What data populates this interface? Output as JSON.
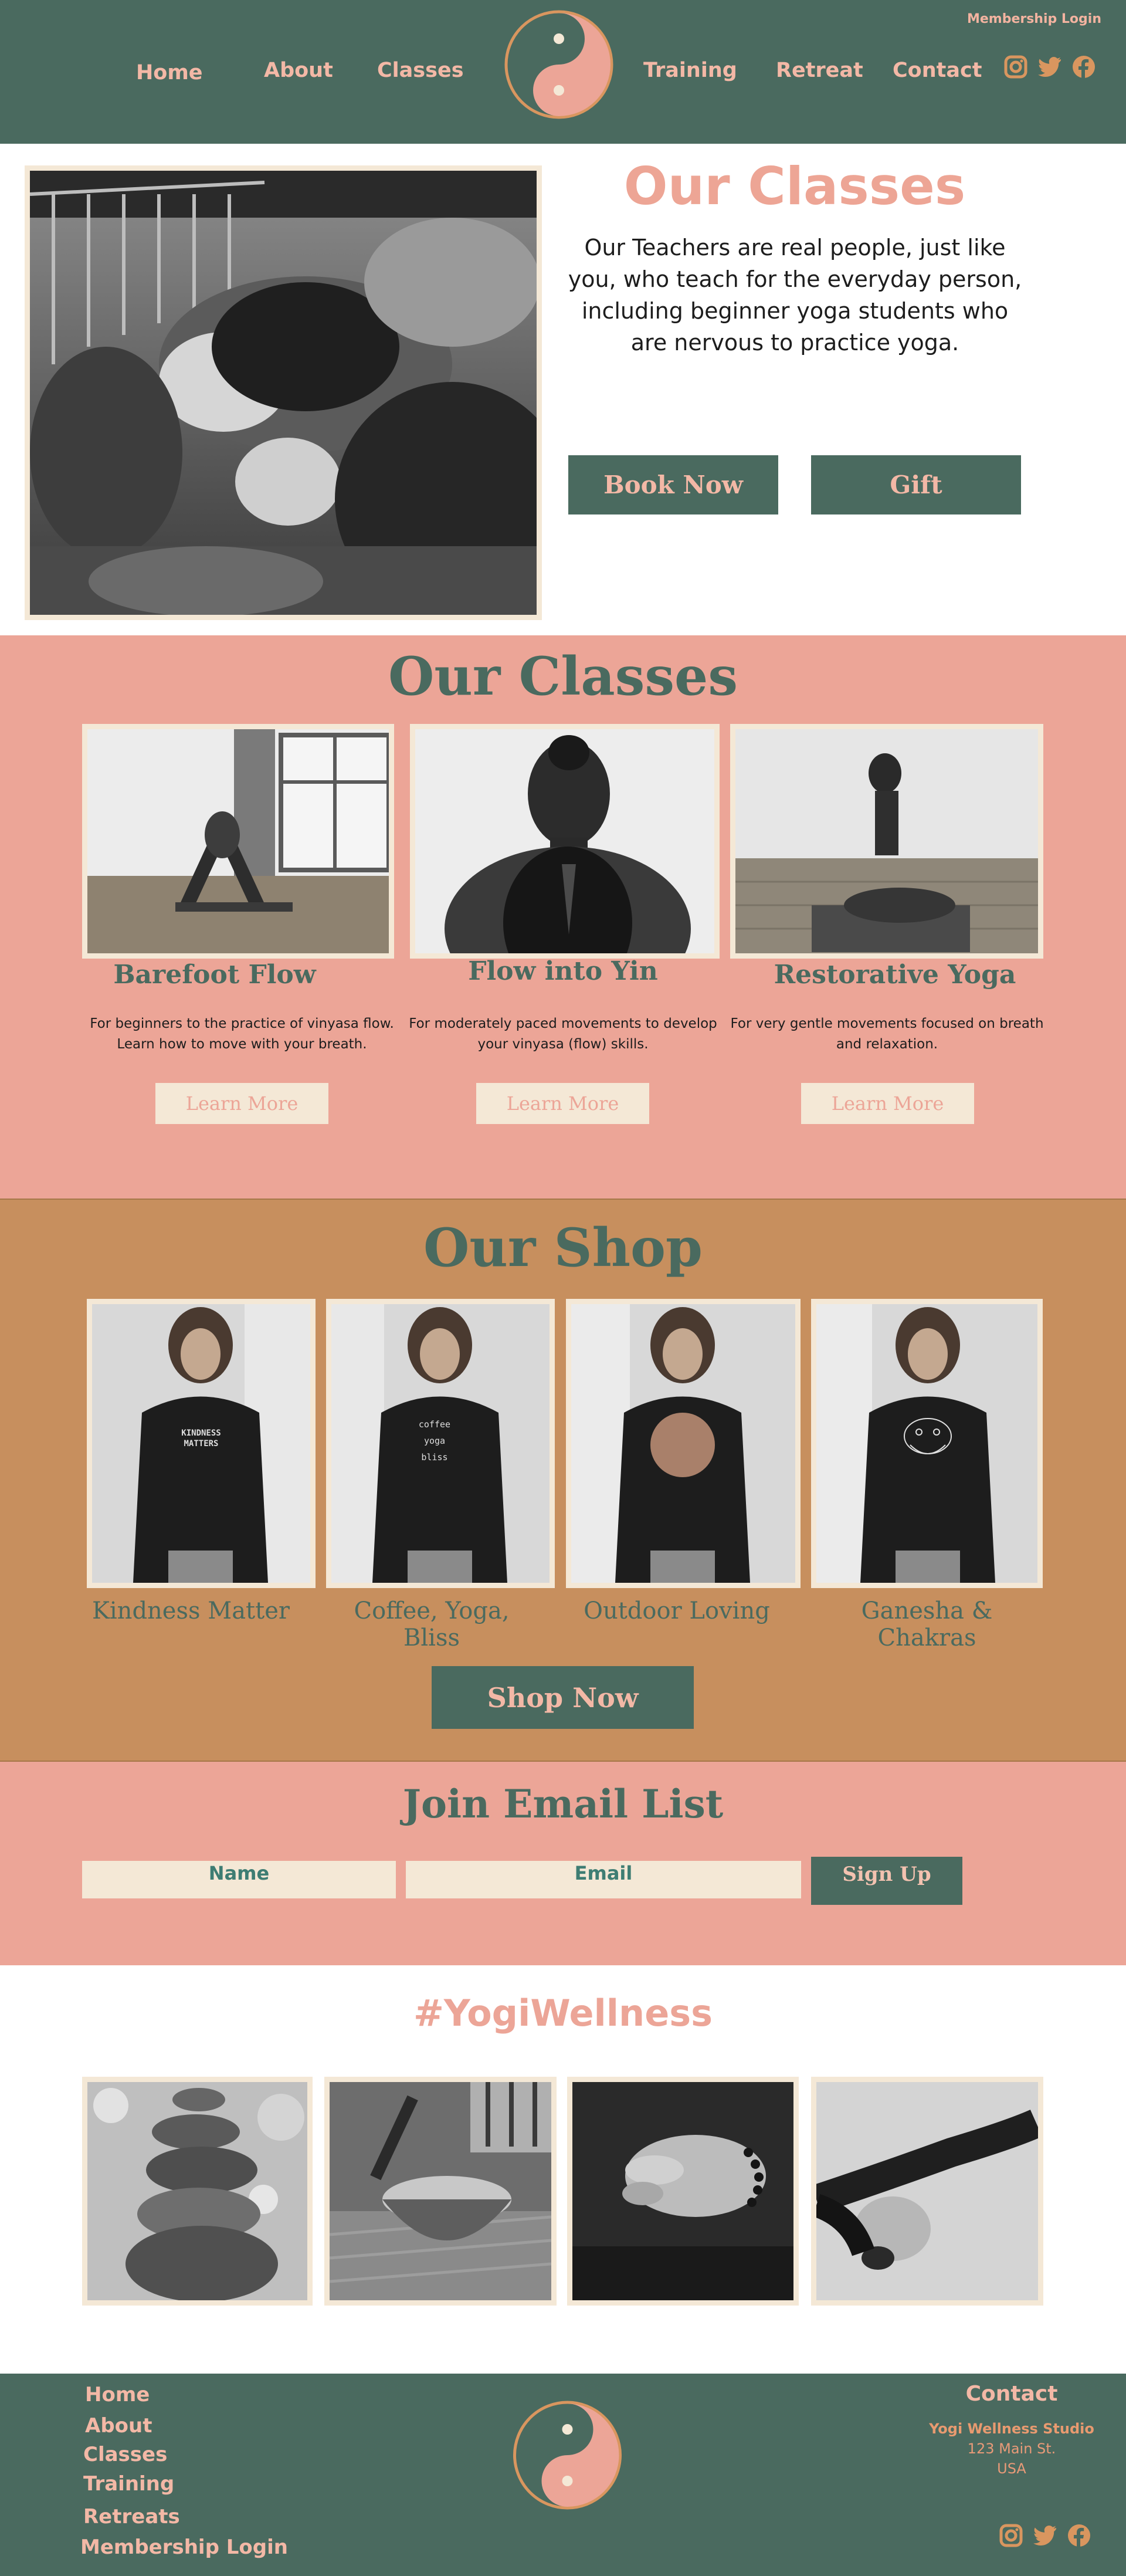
{
  "header": {
    "membership_login": "Membership Login",
    "nav": [
      "Home",
      "About",
      "Classes",
      "Training",
      "Retreat",
      "Contact"
    ],
    "social_icons": [
      "instagram-icon",
      "twitter-icon",
      "facebook-icon"
    ]
  },
  "hero": {
    "title": "Our Classes",
    "text": "Our Teachers are real people, just like you, who teach for the everyday person, including beginner yoga students who are nervous to practice yoga.",
    "book_button": "Book Now",
    "gift_button": "Gift"
  },
  "classes": {
    "title": "Our Classes",
    "items": [
      {
        "name": "Barefoot Flow",
        "desc": "For beginners to the practice of vinyasa flow. Learn how to move with your breath.",
        "button": "Learn More"
      },
      {
        "name": "Flow into Yin",
        "desc": "For moderately paced movements to develop your vinyasa (flow) skills.",
        "button": "Learn More"
      },
      {
        "name": "Restorative Yoga",
        "desc": "For very gentle movements focused on breath and relaxation.",
        "button": "Learn More"
      }
    ]
  },
  "shop": {
    "title": "Our Shop",
    "products": [
      "Kindness Matter",
      "Coffee, Yoga, Bliss",
      "Outdoor Loving",
      "Ganesha & Chakras"
    ],
    "product_prints": [
      "KINDNESS MATTERS",
      "coffee yoga bliss",
      "",
      ""
    ],
    "button": "Shop Now"
  },
  "email": {
    "title": "Join Email List",
    "name_placeholder": "Name",
    "email_placeholder": "Email",
    "button": "Sign Up"
  },
  "wellness": {
    "title": "#YogiWellness"
  },
  "footer": {
    "links": [
      "Home",
      "About",
      "Classes",
      "Training",
      "Retreats",
      "Membership Login"
    ],
    "contact_title": "Contact",
    "studio": "Yogi Wellness Studio",
    "street": "123 Main St.",
    "country": "USA"
  },
  "colors": {
    "green": "#4a6a5f",
    "salmon": "#eca597",
    "cream": "#f4e8d6",
    "tan": "#c78f5e"
  }
}
